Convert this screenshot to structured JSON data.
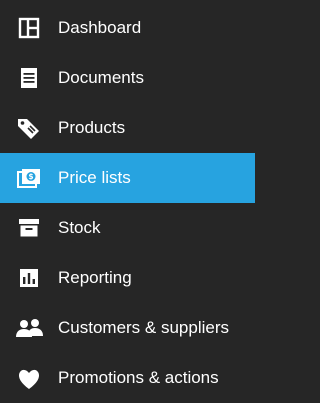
{
  "sidebar": {
    "active_color": "#27a3e0",
    "background_color": "#262626",
    "items": [
      {
        "label": "Dashboard",
        "icon": "dashboard-icon"
      },
      {
        "label": "Documents",
        "icon": "documents-icon"
      },
      {
        "label": "Products",
        "icon": "tag-icon"
      },
      {
        "label": "Price lists",
        "icon": "price-list-icon",
        "active": true
      },
      {
        "label": "Stock",
        "icon": "archive-box-icon"
      },
      {
        "label": "Reporting",
        "icon": "bar-chart-icon"
      },
      {
        "label": "Customers & suppliers",
        "icon": "users-icon"
      },
      {
        "label": "Promotions & actions",
        "icon": "heart-icon"
      }
    ]
  }
}
